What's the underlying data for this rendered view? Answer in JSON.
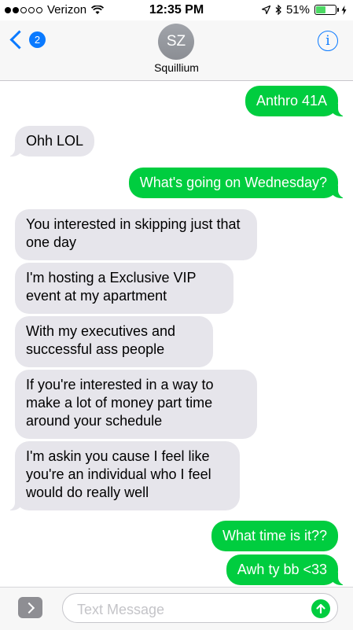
{
  "status_bar": {
    "signal_filled": 2,
    "signal_total": 5,
    "carrier": "Verizon",
    "time": "12:35 PM",
    "battery": "51%",
    "battery_level": 0.51
  },
  "nav": {
    "back_badge": "2",
    "avatar_initials": "SZ",
    "contact_name": "Squillium",
    "info_glyph": "i"
  },
  "messages": [
    {
      "dir": "out",
      "text": "Anthro 41A"
    },
    {
      "dir": "in",
      "text": "Ohh LOL"
    },
    {
      "dir": "out",
      "text": "What's going on Wednesday?"
    },
    {
      "dir": "in",
      "text": "You interested in skipping just that one day"
    },
    {
      "dir": "in",
      "text": "I'm hosting a Exclusive VIP event at my apartment"
    },
    {
      "dir": "in",
      "text": "With my executives and successful ass people"
    },
    {
      "dir": "in",
      "text": "If you're interested in a way to make a lot of money part time around your schedule"
    },
    {
      "dir": "in",
      "text": "I'm askin you cause I feel like you're an individual who I feel would do really well"
    },
    {
      "dir": "out",
      "text": "What time is it??"
    },
    {
      "dir": "out",
      "text": "Awh ty bb <33"
    }
  ],
  "input": {
    "placeholder": "Text Message",
    "value": ""
  },
  "colors": {
    "accent": "#0a7aff",
    "sent_bubble": "#00cd3f",
    "received_bubble": "#e6e5eb"
  }
}
